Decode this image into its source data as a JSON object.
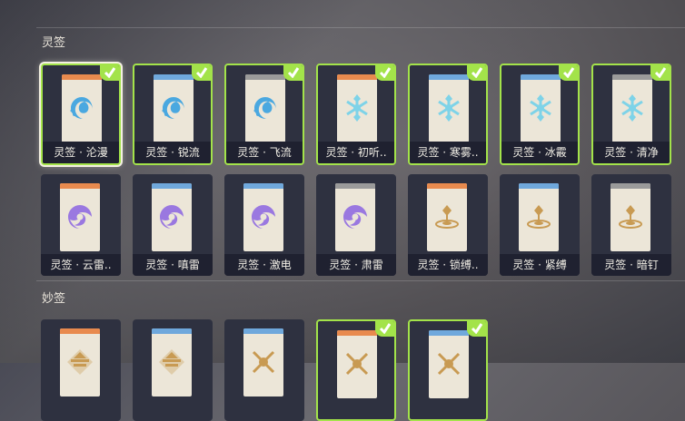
{
  "sections": [
    {
      "title": "灵签"
    },
    {
      "title": "妙签"
    }
  ],
  "stripe_colors": {
    "orange": "#e88a4e",
    "blue": "#6fa8dc",
    "gray": "#9a9a9a"
  },
  "accent_equipped": "#a3e34a",
  "cards": [
    {
      "label": "灵签 · 沦漫",
      "element": "hydro",
      "stripe": "orange",
      "selected": true,
      "equipped": true
    },
    {
      "label": "灵签 · 锐流",
      "element": "hydro",
      "stripe": "blue",
      "selected": false,
      "equipped": true
    },
    {
      "label": "灵签 · 飞流",
      "element": "hydro",
      "stripe": "gray",
      "selected": false,
      "equipped": true
    },
    {
      "label": "灵签 · 初听..",
      "element": "cryo",
      "stripe": "orange",
      "selected": false,
      "equipped": true
    },
    {
      "label": "灵签 · 寒雾..",
      "element": "cryo",
      "stripe": "blue",
      "selected": false,
      "equipped": true
    },
    {
      "label": "灵签 · 冰霰",
      "element": "cryo",
      "stripe": "blue",
      "selected": false,
      "equipped": true
    },
    {
      "label": "灵签 · 清净",
      "element": "cryo",
      "stripe": "gray",
      "selected": false,
      "equipped": true
    },
    {
      "label": "灵签 · 云雷..",
      "element": "electro",
      "stripe": "orange",
      "selected": false,
      "equipped": false
    },
    {
      "label": "灵签 · 嗔雷",
      "element": "electro",
      "stripe": "blue",
      "selected": false,
      "equipped": false
    },
    {
      "label": "灵签 · 激电",
      "element": "electro",
      "stripe": "blue",
      "selected": false,
      "equipped": false
    },
    {
      "label": "灵签 · 肃雷",
      "element": "electro",
      "stripe": "gray",
      "selected": false,
      "equipped": false
    },
    {
      "label": "灵签 · 锁缚..",
      "element": "geo",
      "stripe": "orange",
      "selected": false,
      "equipped": false
    },
    {
      "label": "灵签 · 紧缚",
      "element": "geo",
      "stripe": "blue",
      "selected": false,
      "equipped": false
    },
    {
      "label": "灵签 · 暗钉",
      "element": "geo",
      "stripe": "gray",
      "selected": false,
      "equipped": false
    },
    {
      "label": "",
      "element": "miao",
      "stripe": "orange",
      "selected": false,
      "equipped": false
    },
    {
      "label": "",
      "element": "miao",
      "stripe": "blue",
      "selected": false,
      "equipped": false
    },
    {
      "label": "",
      "element": "miao2",
      "stripe": "blue",
      "selected": false,
      "equipped": false
    },
    {
      "label": "",
      "element": "miao2",
      "stripe": "orange",
      "selected": false,
      "equipped": true
    },
    {
      "label": "",
      "element": "miao2",
      "stripe": "blue",
      "selected": false,
      "equipped": true
    }
  ],
  "icons": {
    "hydro": "hydro-element-icon",
    "cryo": "cryo-element-icon",
    "electro": "electro-element-icon",
    "geo": "geo-element-icon",
    "miao": "miao-pattern-icon",
    "miao2": "crossed-swords-pattern-icon",
    "check": "check-icon"
  }
}
